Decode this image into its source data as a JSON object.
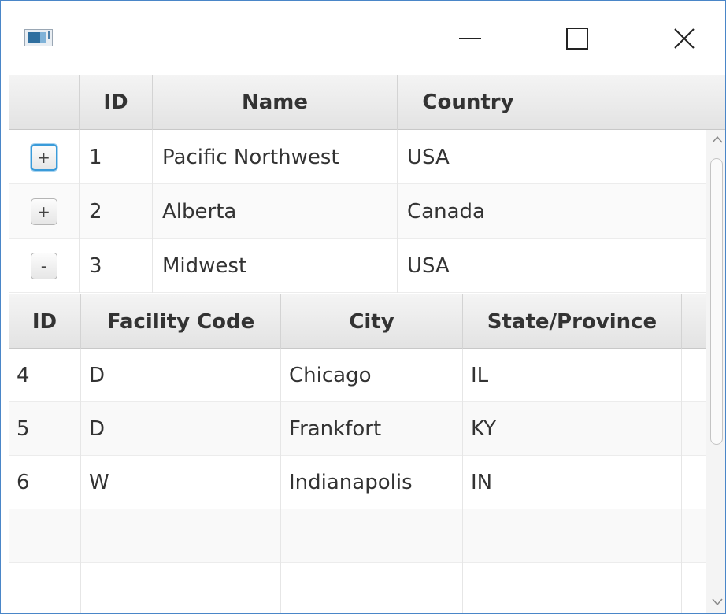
{
  "window": {
    "title": "",
    "icons": {
      "app": "app-window-icon",
      "minimize": "minimize-icon",
      "maximize": "maximize-icon",
      "close": "close-icon"
    }
  },
  "outer_table": {
    "columns": [
      "",
      "ID",
      "Name",
      "Country",
      ""
    ],
    "rows": [
      {
        "toggle": "+",
        "id": "1",
        "name": "Pacific Northwest",
        "country": "USA"
      },
      {
        "toggle": "+",
        "id": "2",
        "name": "Alberta",
        "country": "Canada"
      },
      {
        "toggle": "-",
        "id": "3",
        "name": "Midwest",
        "country": "USA"
      }
    ]
  },
  "inner_table": {
    "columns": [
      "ID",
      "Facility Code",
      "City",
      "State/Province"
    ],
    "rows": [
      {
        "id": "4",
        "facility_code": "D",
        "city": "Chicago",
        "state": "IL"
      },
      {
        "id": "5",
        "facility_code": "D",
        "city": "Frankfort",
        "state": "KY"
      },
      {
        "id": "6",
        "facility_code": "W",
        "city": "Indianapolis",
        "state": "IN"
      }
    ]
  },
  "colors": {
    "focus": "#3a9bd9",
    "window_border": "#4a86c8"
  }
}
